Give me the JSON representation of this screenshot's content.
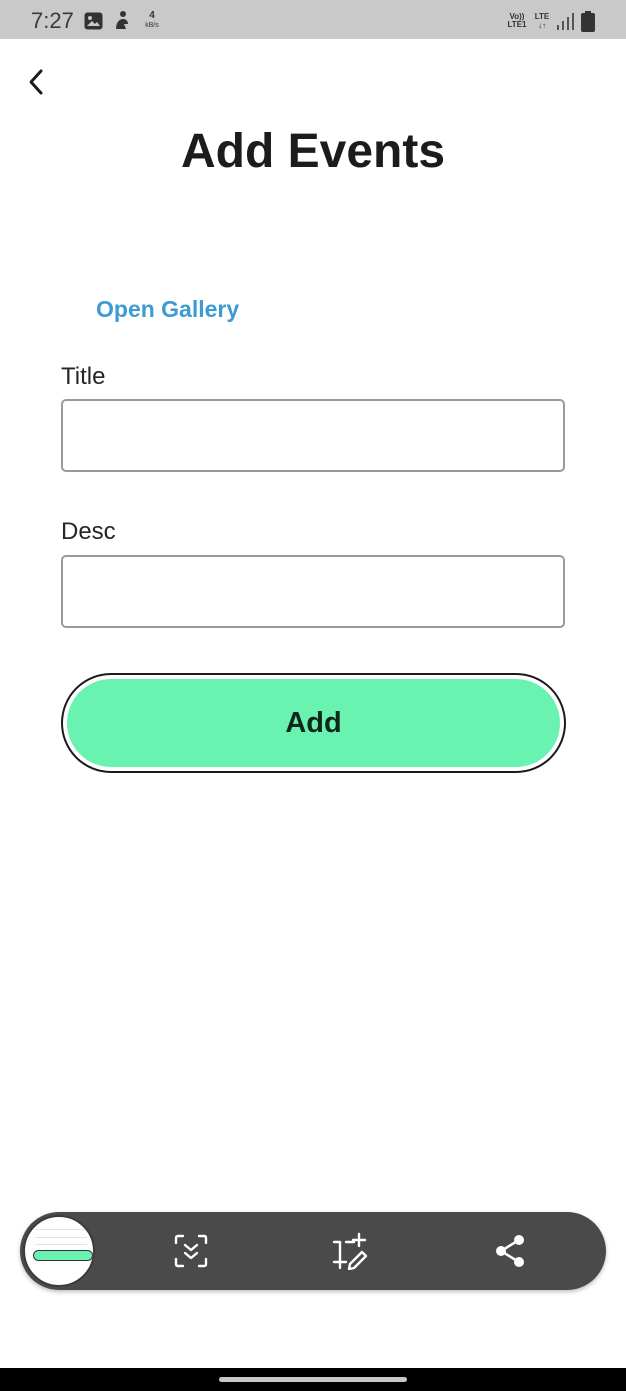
{
  "status_bar": {
    "time": "7:27",
    "net_speed_value": "4",
    "net_speed_unit": "kB/s",
    "volte_top": "Vo))",
    "volte_bottom": "LTE1",
    "lte_top": "LTE",
    "lte_bottom": "↓↑",
    "icons": [
      "image-icon",
      "person-icon",
      "signal-icon",
      "battery-icon"
    ]
  },
  "header": {
    "back_icon": "chevron-left-icon",
    "title": "Add Events"
  },
  "form": {
    "gallery_link": "Open Gallery",
    "title_label": "Title",
    "title_value": "",
    "desc_label": "Desc",
    "desc_value": "",
    "add_label": "Add"
  },
  "screenshot_toolbar": {
    "thumb_button_label": "Add",
    "tools": [
      "scan-icon",
      "crop-edit-icon",
      "share-icon"
    ]
  },
  "colors": {
    "accent_link": "#3d9bd4",
    "add_button": "#6af2b0",
    "toolbar": "#4a4a4a",
    "status_bar": "#c9c9c9"
  }
}
